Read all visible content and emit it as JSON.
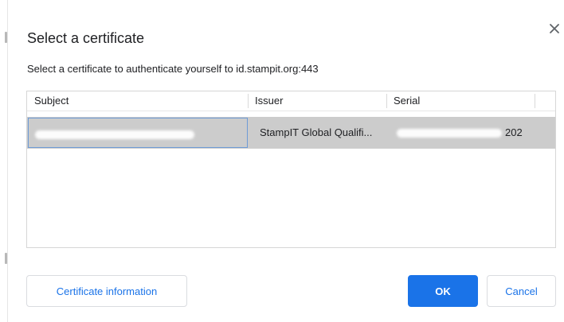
{
  "dialog": {
    "title": "Select a certificate",
    "subtitle": "Select a certificate to authenticate yourself to id.stampit.org:443",
    "close_icon": "close-icon"
  },
  "table": {
    "columns": [
      "Subject",
      "Issuer",
      "Serial"
    ],
    "rows": [
      {
        "subject_visible": "",
        "issuer": "StampIT Global Qualifi...",
        "serial_visible": "202",
        "selected": true
      }
    ]
  },
  "buttons": {
    "certificate_info": "Certificate information",
    "ok": "OK",
    "cancel": "Cancel"
  },
  "colors": {
    "accent": "#1a73e8",
    "selected_row": "#cccccc",
    "focus_border": "#6e9bd6"
  }
}
